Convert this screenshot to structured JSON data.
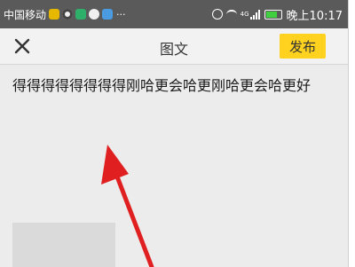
{
  "status_bar": {
    "carrier": "中国移动",
    "more": "···",
    "network_label": "4G",
    "time": "晚上10:17"
  },
  "top_bar": {
    "close_icon": "close-icon",
    "title": "图文",
    "publish_label": "发布"
  },
  "editor": {
    "text": "得得得得得得得得刚哈更会哈更刚哈更会哈更好"
  },
  "colors": {
    "status_bar_bg": "#5a5a5a",
    "publish_button": "#ffd21f",
    "editor_bg": "#ececec",
    "annotation_arrow": "#e02020"
  }
}
